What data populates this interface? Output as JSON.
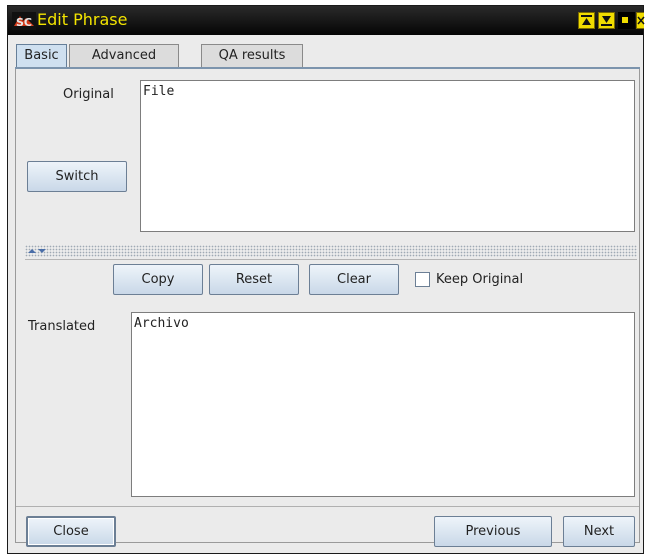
{
  "window": {
    "title": "Edit Phrase",
    "logo_text": "SC",
    "title_buttons": [
      "minimize-up-icon",
      "minimize-down-icon",
      "maximize-icon",
      "close-icon"
    ],
    "title_color": "#f3e400",
    "titlebar_color": "#000000"
  },
  "tabs": [
    {
      "label": "Basic",
      "active": true
    },
    {
      "label": "Advanced",
      "active": false
    },
    {
      "label": "QA results",
      "active": false
    }
  ],
  "original": {
    "label": "Original",
    "mnemonic": "O",
    "value": "File",
    "switch_button": "Switch"
  },
  "actions": {
    "copy": "Copy",
    "reset": "Reset",
    "clear": "Clear",
    "keep_original_label": "Keep Original",
    "keep_original_checked": false
  },
  "translated": {
    "label": "Translated",
    "value": "Archivo"
  },
  "footer": {
    "close": "Close",
    "previous": "Previous",
    "next": "Next"
  }
}
